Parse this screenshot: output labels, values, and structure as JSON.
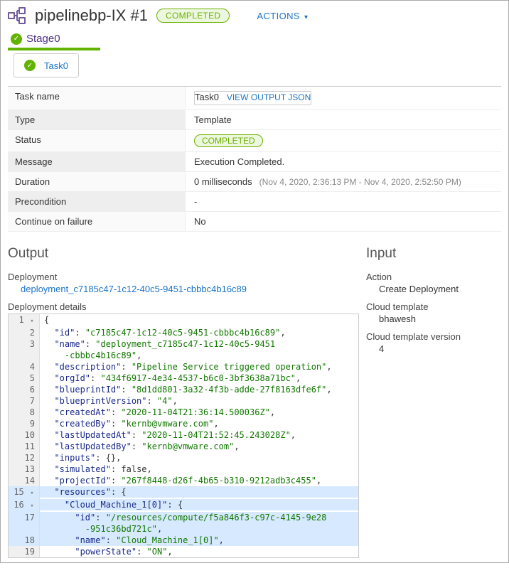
{
  "header": {
    "title": "pipelinebp-IX #1",
    "status_pill": "COMPLETED",
    "actions_label": "ACTIONS"
  },
  "stage": {
    "name": "Stage0",
    "task_name": "Task0"
  },
  "details": {
    "rows": [
      {
        "label": "Task name",
        "value": "Task0"
      },
      {
        "label": "Type",
        "value": "Template"
      },
      {
        "label": "Status",
        "value": "COMPLETED"
      },
      {
        "label": "Message",
        "value": "Execution Completed."
      },
      {
        "label": "Duration",
        "value": "0 milliseconds",
        "suffix": "(Nov 4, 2020, 2:36:13 PM - Nov 4, 2020, 2:52:50 PM)"
      },
      {
        "label": "Precondition",
        "value": "-"
      },
      {
        "label": "Continue on failure",
        "value": "No"
      }
    ],
    "view_output_label": "VIEW OUTPUT JSON"
  },
  "output": {
    "title": "Output",
    "deployment_label": "Deployment",
    "deployment_link": "deployment_c7185c47-1c12-40c5-9451-cbbbc4b16c89",
    "details_label": "Deployment details",
    "json_lines": [
      {
        "n": "1",
        "fold": "▾",
        "indent": 0,
        "tokens": [
          [
            "p",
            "{"
          ]
        ]
      },
      {
        "n": "2",
        "indent": 1,
        "tokens": [
          [
            "k",
            "\"id\""
          ],
          [
            "p",
            ": "
          ],
          [
            "s",
            "\"c7185c47-1c12-40c5-9451-cbbbc4b16c89\""
          ],
          [
            "p",
            ","
          ]
        ]
      },
      {
        "n": "3",
        "indent": 1,
        "tokens": [
          [
            "k",
            "\"name\""
          ],
          [
            "p",
            ": "
          ],
          [
            "s",
            "\"deployment_c7185c47-1c12-40c5-9451"
          ]
        ],
        "cont": true
      },
      {
        "n": "",
        "indent": 2,
        "tokens": [
          [
            "s",
            "-cbbbc4b16c89\""
          ],
          [
            "p",
            ","
          ]
        ]
      },
      {
        "n": "4",
        "indent": 1,
        "tokens": [
          [
            "k",
            "\"description\""
          ],
          [
            "p",
            ": "
          ],
          [
            "s",
            "\"Pipeline Service triggered operation\""
          ],
          [
            "p",
            ","
          ]
        ]
      },
      {
        "n": "5",
        "indent": 1,
        "tokens": [
          [
            "k",
            "\"orgId\""
          ],
          [
            "p",
            ": "
          ],
          [
            "s",
            "\"434f6917-4e34-4537-b6c0-3bf3638a71bc\""
          ],
          [
            "p",
            ","
          ]
        ]
      },
      {
        "n": "6",
        "indent": 1,
        "tokens": [
          [
            "k",
            "\"blueprintId\""
          ],
          [
            "p",
            ": "
          ],
          [
            "s",
            "\"8d1dd801-3a32-4f3b-adde-27f8163dfe6f\""
          ],
          [
            "p",
            ","
          ]
        ]
      },
      {
        "n": "7",
        "indent": 1,
        "tokens": [
          [
            "k",
            "\"blueprintVersion\""
          ],
          [
            "p",
            ": "
          ],
          [
            "s",
            "\"4\""
          ],
          [
            "p",
            ","
          ]
        ]
      },
      {
        "n": "8",
        "indent": 1,
        "tokens": [
          [
            "k",
            "\"createdAt\""
          ],
          [
            "p",
            ": "
          ],
          [
            "s",
            "\"2020-11-04T21:36:14.500036Z\""
          ],
          [
            "p",
            ","
          ]
        ]
      },
      {
        "n": "9",
        "indent": 1,
        "tokens": [
          [
            "k",
            "\"createdBy\""
          ],
          [
            "p",
            ": "
          ],
          [
            "s",
            "\"kernb@vmware.com\""
          ],
          [
            "p",
            ","
          ]
        ]
      },
      {
        "n": "10",
        "indent": 1,
        "tokens": [
          [
            "k",
            "\"lastUpdatedAt\""
          ],
          [
            "p",
            ": "
          ],
          [
            "s",
            "\"2020-11-04T21:52:45.243028Z\""
          ],
          [
            "p",
            ","
          ]
        ]
      },
      {
        "n": "11",
        "indent": 1,
        "tokens": [
          [
            "k",
            "\"lastUpdatedBy\""
          ],
          [
            "p",
            ": "
          ],
          [
            "s",
            "\"kernb@vmware.com\""
          ],
          [
            "p",
            ","
          ]
        ]
      },
      {
        "n": "12",
        "indent": 1,
        "tokens": [
          [
            "k",
            "\"inputs\""
          ],
          [
            "p",
            ": "
          ],
          [
            "p",
            "{},"
          ]
        ]
      },
      {
        "n": "13",
        "indent": 1,
        "tokens": [
          [
            "k",
            "\"simulated\""
          ],
          [
            "p",
            ": "
          ],
          [
            "p",
            "false,"
          ]
        ]
      },
      {
        "n": "14",
        "indent": 1,
        "tokens": [
          [
            "k",
            "\"projectId\""
          ],
          [
            "p",
            ": "
          ],
          [
            "s",
            "\"267f8448-d26f-4b65-b310-9212adb3c455\""
          ],
          [
            "p",
            ","
          ]
        ]
      },
      {
        "n": "15",
        "fold": "▾",
        "hl": true,
        "indent": 1,
        "tokens": [
          [
            "k",
            "\"resources\""
          ],
          [
            "p",
            ": "
          ],
          [
            "p",
            "{"
          ]
        ]
      },
      {
        "n": "16",
        "fold": "▾",
        "hl": true,
        "indent": 2,
        "tokens": [
          [
            "k",
            "\"Cloud_Machine_1[0]\""
          ],
          [
            "p",
            ": "
          ],
          [
            "p",
            "{"
          ]
        ]
      },
      {
        "n": "17",
        "hl": true,
        "indent": 3,
        "tokens": [
          [
            "k",
            "\"id\""
          ],
          [
            "p",
            ": "
          ],
          [
            "s",
            "\"/resources/compute/f5a846f3-c97c-4145-9e28"
          ]
        ],
        "cont": true
      },
      {
        "n": "",
        "hl": true,
        "indent": 4,
        "tokens": [
          [
            "s",
            "-951c36bd721c\""
          ],
          [
            "p",
            ","
          ]
        ]
      },
      {
        "n": "18",
        "hl": true,
        "indent": 3,
        "tokens": [
          [
            "k",
            "\"name\""
          ],
          [
            "p",
            ": "
          ],
          [
            "s",
            "\"Cloud_Machine_1[0]\""
          ],
          [
            "p",
            ","
          ]
        ]
      },
      {
        "n": "19",
        "indent": 3,
        "tokens": [
          [
            "k",
            "\"powerState\""
          ],
          [
            "p",
            ": "
          ],
          [
            "s",
            "\"ON\""
          ],
          [
            "p",
            ","
          ]
        ]
      }
    ]
  },
  "input": {
    "title": "Input",
    "action_label": "Action",
    "action_value": "Create Deployment",
    "template_label": "Cloud template",
    "template_value": "bhawesh",
    "version_label": "Cloud template version",
    "version_value": "4"
  },
  "chart_data": {
    "type": "table",
    "title": "Deployment details JSON",
    "data": {
      "id": "c7185c47-1c12-40c5-9451-cbbbc4b16c89",
      "name": "deployment_c7185c47-1c12-40c5-9451-cbbbc4b16c89",
      "description": "Pipeline Service triggered operation",
      "orgId": "434f6917-4e34-4537-b6c0-3bf3638a71bc",
      "blueprintId": "8d1dd801-3a32-4f3b-adde-27f8163dfe6f",
      "blueprintVersion": "4",
      "createdAt": "2020-11-04T21:36:14.500036Z",
      "createdBy": "kernb@vmware.com",
      "lastUpdatedAt": "2020-11-04T21:52:45.243028Z",
      "lastUpdatedBy": "kernb@vmware.com",
      "inputs": {},
      "simulated": false,
      "projectId": "267f8448-d26f-4b65-b310-9212adb3c455",
      "resources": {
        "Cloud_Machine_1[0]": {
          "id": "/resources/compute/f5a846f3-c97c-4145-9e28-951c36bd721c",
          "name": "Cloud_Machine_1[0]",
          "powerState": "ON"
        }
      }
    }
  }
}
